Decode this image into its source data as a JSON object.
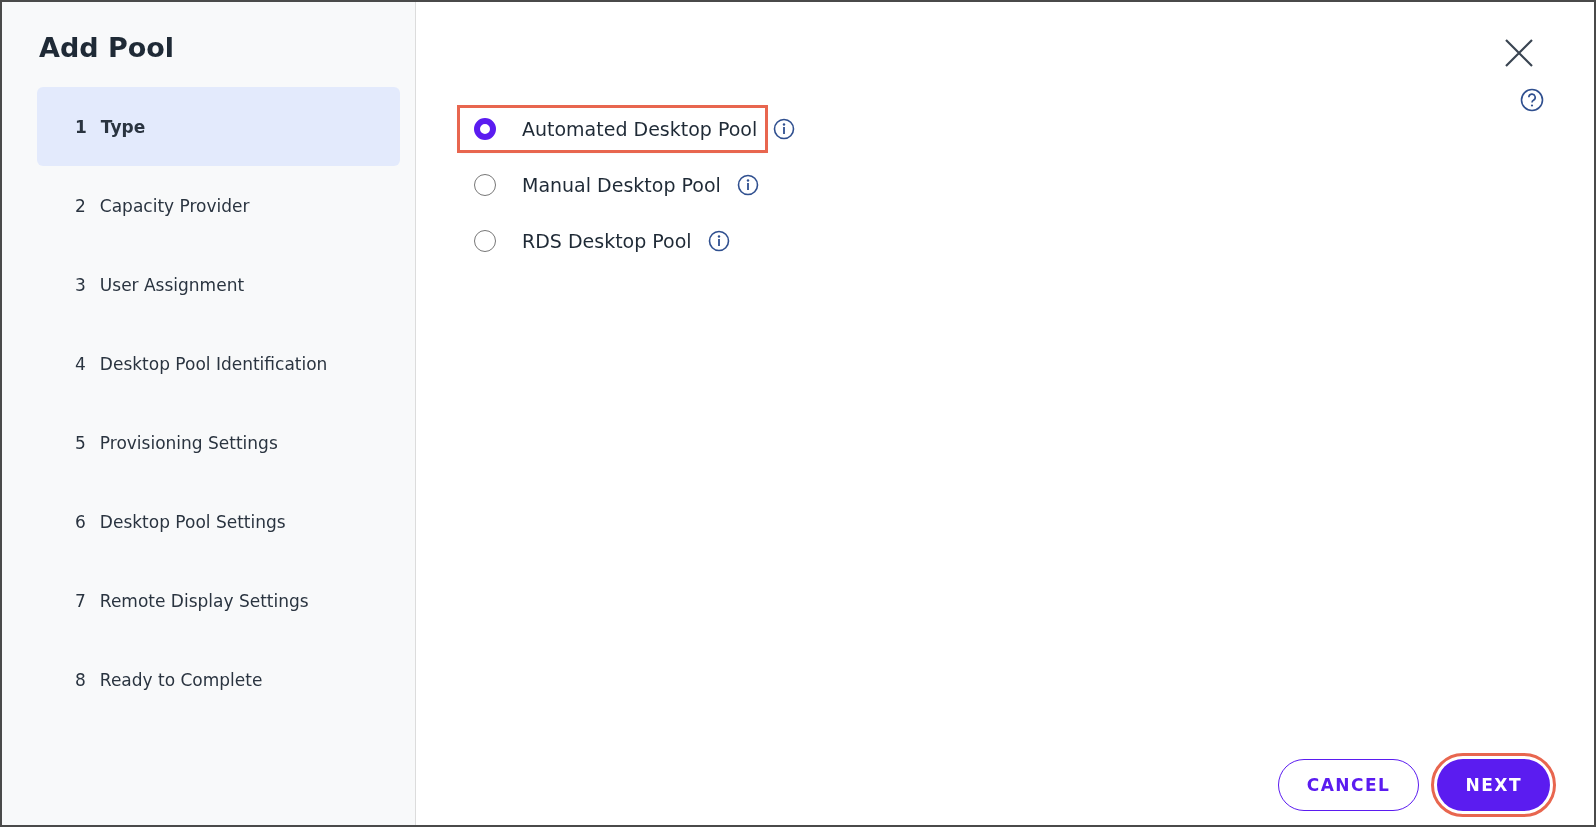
{
  "dialog": {
    "title": "Add Pool"
  },
  "steps": [
    {
      "number": "1",
      "label": "Type",
      "selected": true
    },
    {
      "number": "2",
      "label": "Capacity Provider",
      "selected": false
    },
    {
      "number": "3",
      "label": "User Assignment",
      "selected": false
    },
    {
      "number": "4",
      "label": "Desktop Pool Identification",
      "selected": false
    },
    {
      "number": "5",
      "label": "Provisioning Settings",
      "selected": false
    },
    {
      "number": "6",
      "label": "Desktop Pool Settings",
      "selected": false
    },
    {
      "number": "7",
      "label": "Remote Display Settings",
      "selected": false
    },
    {
      "number": "8",
      "label": "Ready to Complete",
      "selected": false
    }
  ],
  "options": [
    {
      "label": "Automated Desktop Pool",
      "selected": true,
      "highlighted": true
    },
    {
      "label": "Manual Desktop Pool",
      "selected": false,
      "highlighted": false
    },
    {
      "label": "RDS Desktop Pool",
      "selected": false,
      "highlighted": false
    }
  ],
  "buttons": [
    {
      "label": "CANCEL",
      "kind": "secondary",
      "highlighted": false
    },
    {
      "label": "NEXT",
      "kind": "primary",
      "highlighted": true
    }
  ]
}
